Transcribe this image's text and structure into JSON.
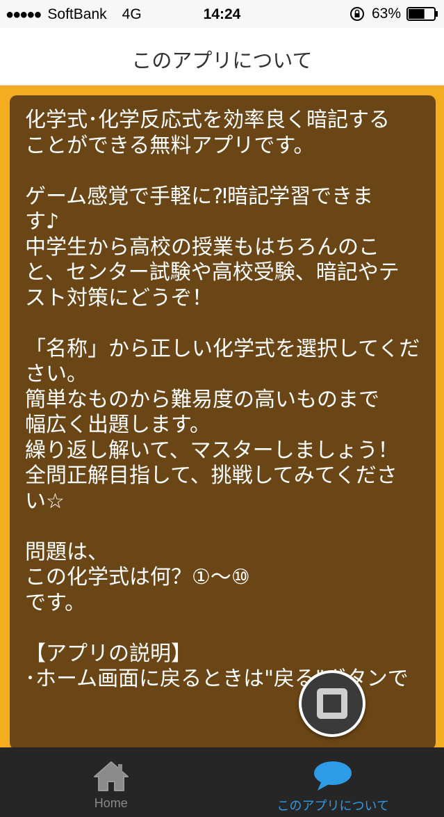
{
  "status_bar": {
    "signal_dots": "●●●●●",
    "carrier": "SoftBank",
    "network": "4G",
    "time": "14:24",
    "battery_percent": "63%",
    "battery_level": 0.63
  },
  "nav": {
    "title": "このアプリについて"
  },
  "content": {
    "paragraphs": [
      "化学式･化学反応式を効率良く暗記する\nことができる無料アプリです。",
      "ゲーム感覚で手軽に⁈暗記学習できま\nす♪\n中学生から高校の授業もはちろんのこ\nと、センター試験や高校受験、暗記やテ\nスト対策にどうぞ！",
      "「名称」から正しい化学式を選択してくだ\nさい。\n簡単なものから難易度の高いものまで\n幅広く出題します。\n繰り返し解いて、マスターしましょう！\n全問正解目指して、挑戦してみてくださ\nい☆",
      "問題は、\nこの化学式は何？①〜⑩\nです。",
      "【アプリの説明】\n･ホーム画面に戻るときは\"戻る\"ボタンで"
    ]
  },
  "tabs": [
    {
      "label": "Home",
      "icon": "home-icon",
      "active": false
    },
    {
      "label": "このアプリについて",
      "icon": "speech-bubble-icon",
      "active": true
    }
  ],
  "colors": {
    "accent_border": "#f4ad1f",
    "card_bg": "#6a4616",
    "tab_active": "#2d9be5",
    "tab_bar_bg": "#262626"
  }
}
